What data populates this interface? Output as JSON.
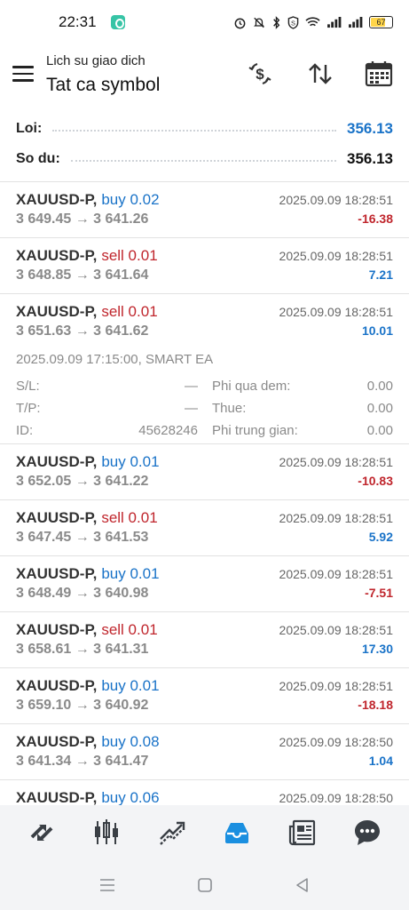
{
  "status_bar": {
    "time": "22:31",
    "battery": "67"
  },
  "header": {
    "subtitle": "Lich su giao dich",
    "title": "Tat ca symbol"
  },
  "summary": {
    "profit_label": "Loi:",
    "profit_value": "356.13",
    "balance_label": "So du:",
    "balance_value": "356.13"
  },
  "trades": [
    {
      "symbol": "XAUUSD-P,",
      "side": "buy 0.02",
      "time": "2025.09.09 18:28:51",
      "prices": "3 649.45 → 3 641.26",
      "profit": "-16.38"
    },
    {
      "symbol": "XAUUSD-P,",
      "side": "sell 0.01",
      "time": "2025.09.09 18:28:51",
      "prices": "3 648.85 → 3 641.64",
      "profit": "7.21"
    },
    {
      "symbol": "XAUUSD-P,",
      "side": "sell 0.01",
      "time": "2025.09.09 18:28:51",
      "prices": "3 651.63 → 3 641.62",
      "profit": "10.01"
    },
    {
      "symbol": "XAUUSD-P,",
      "side": "buy 0.01",
      "time": "2025.09.09 18:28:51",
      "prices": "3 652.05 → 3 641.22",
      "profit": "-10.83"
    },
    {
      "symbol": "XAUUSD-P,",
      "side": "sell 0.01",
      "time": "2025.09.09 18:28:51",
      "prices": "3 647.45 → 3 641.53",
      "profit": "5.92"
    },
    {
      "symbol": "XAUUSD-P,",
      "side": "buy 0.01",
      "time": "2025.09.09 18:28:51",
      "prices": "3 648.49 → 3 640.98",
      "profit": "-7.51"
    },
    {
      "symbol": "XAUUSD-P,",
      "side": "sell 0.01",
      "time": "2025.09.09 18:28:51",
      "prices": "3 658.61 → 3 641.31",
      "profit": "17.30"
    },
    {
      "symbol": "XAUUSD-P,",
      "side": "buy 0.01",
      "time": "2025.09.09 18:28:51",
      "prices": "3 659.10 → 3 640.92",
      "profit": "-18.18"
    },
    {
      "symbol": "XAUUSD-P,",
      "side": "buy 0.08",
      "time": "2025.09.09 18:28:50",
      "prices": "3 641.34 → 3 641.47",
      "profit": "1.04"
    },
    {
      "symbol": "XAUUSD-P,",
      "side": "buy 0.06",
      "time": "2025.09.09 18:28:50",
      "prices": "",
      "profit": ""
    }
  ],
  "expanded_details": {
    "comment": "2025.09.09 17:15:00, SMART EA",
    "sl_label": "S/L:",
    "sl_value": "—",
    "tp_label": "T/P:",
    "tp_value": "—",
    "id_label": "ID:",
    "id_value": "45628246",
    "swap_label": "Phi qua dem:",
    "swap_value": "0.00",
    "tax_label": "Thue:",
    "tax_value": "0.00",
    "commission_label": "Phi trung gian:",
    "commission_value": "0.00"
  },
  "colors": {
    "buy": "#1a73c8",
    "sell": "#c0262d",
    "accent": "#1a73c8"
  },
  "bottom_nav": [
    {
      "icon": "quotes-icon",
      "active": false
    },
    {
      "icon": "chart-icon",
      "active": false
    },
    {
      "icon": "trade-icon",
      "active": false
    },
    {
      "icon": "history-icon",
      "active": true
    },
    {
      "icon": "news-icon",
      "active": false
    },
    {
      "icon": "messages-icon",
      "active": false
    }
  ]
}
